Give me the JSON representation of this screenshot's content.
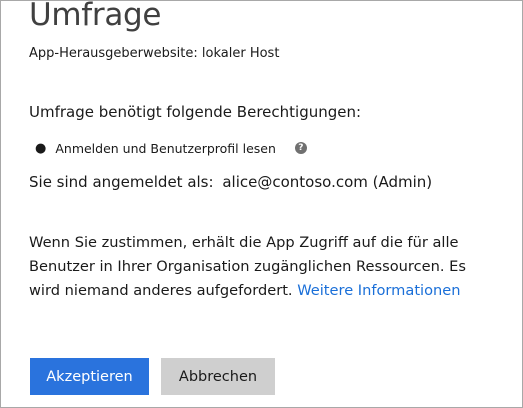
{
  "dialog": {
    "title": "Umfrage",
    "publisher": "App-Herausgeberwebsite: lokaler Host",
    "permissions_heading": "Umfrage benötigt folgende Berechtigungen:",
    "permissions": [
      {
        "label": "Anmelden und Benutzerprofil lesen",
        "help_icon": "question-circle-icon"
      }
    ],
    "signed_in_label": "Sie sind angemeldet als:",
    "signed_in_account": "alice@contoso.com (Admin)",
    "consent_text": "Wenn Sie zustimmen, erhält die App Zugriff auf die für alle Benutzer in Ihrer Organisation zugänglichen Ressourcen. Es wird niemand anderes aufgefordert.",
    "more_info_link": "Weitere Informationen",
    "accept_label": "Akzeptieren",
    "cancel_label": "Abbrechen"
  },
  "colors": {
    "accent": "#2a73dd",
    "link": "#1a6fd8",
    "secondary_button": "#cfcfcf",
    "title": "#404040"
  }
}
